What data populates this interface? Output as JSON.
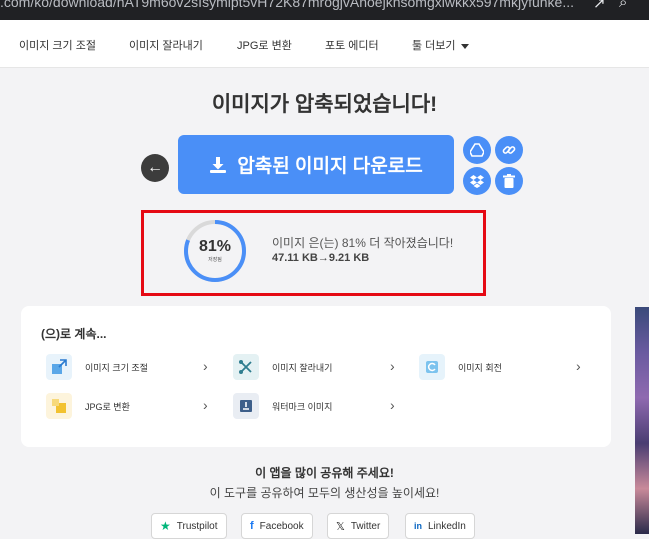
{
  "browser": {
    "url": ".com/ko/download/nAT9m6ov2sIsymipt5vH72K87mrogjvAnoejknsomgxiwkkx597mkjyfunke..."
  },
  "nav": {
    "items": [
      "이미지 크기 조절",
      "이미지 잘라내기",
      "JPG로 변환",
      "포토 에디터"
    ],
    "more": "툴 더보기"
  },
  "result": {
    "title": "이미지가 압축되었습니다!",
    "download_label": "압축된 이미지 다운로드",
    "percent_label": "81%",
    "percent_value": 81,
    "percent_sub": "저장됨",
    "message": "이미지 은(는) 81% 더 작아졌습니다!",
    "size_from": "47.11 KB",
    "size_to": "9.21 KB",
    "arrow": "→"
  },
  "continue": {
    "title": "(으)로 계속...",
    "tools": [
      {
        "label": "이미지 크기 조절",
        "icon": "resize-icon",
        "color": "#e8f3fb"
      },
      {
        "label": "이미지 잘라내기",
        "icon": "crop-icon",
        "color": "#e4f1f3"
      },
      {
        "label": "이미지 회전",
        "icon": "rotate-icon",
        "color": "#e6f3fb"
      },
      {
        "label": "JPG로 변환",
        "icon": "jpg-convert-icon",
        "color": "#fdf4dc"
      },
      {
        "label": "워터마크 이미지",
        "icon": "watermark-icon",
        "color": "#e9edf3"
      }
    ]
  },
  "share": {
    "title": "이 앱을 많이 공유해 주세요!",
    "subtitle": "이 도구를 공유하여 모두의 생산성을 높이세요!",
    "buttons": [
      "Trustpilot",
      "Facebook",
      "Twitter",
      "LinkedIn"
    ]
  },
  "colors": {
    "accent": "#4a8ff7",
    "highlight_box": "#e50914",
    "trustpilot_star": "#00b67a",
    "facebook": "#1877f2",
    "linkedin": "#0a66c2"
  }
}
